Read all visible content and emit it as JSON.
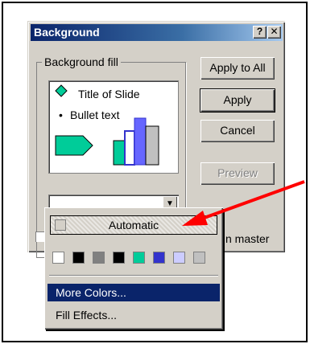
{
  "dialog": {
    "title": "Background",
    "help_label": "?",
    "close_label": "✕"
  },
  "group": {
    "label": "Background fill"
  },
  "preview": {
    "slide_title": "Title of Slide",
    "bullet_glyph": "•",
    "bullet_text": "Bullet text"
  },
  "buttons": {
    "apply_all": "Apply to All",
    "apply": "Apply",
    "cancel": "Cancel",
    "preview": "Preview"
  },
  "master_checkbox": {
    "label_tail": "n master"
  },
  "dropdown": {
    "automatic_label": "Automatic",
    "more_colors": "More Colors...",
    "fill_effects": "Fill Effects...",
    "swatch_colors": [
      "#ffffff",
      "#000000",
      "#808080",
      "#000000",
      "#00cc99",
      "#3333cc",
      "#ccccff",
      "#c0c0c0"
    ]
  },
  "colors": {
    "annotation_arrow": "#ff0000",
    "highlight": "#0a246a",
    "dialog_face": "#d4d0c8"
  }
}
